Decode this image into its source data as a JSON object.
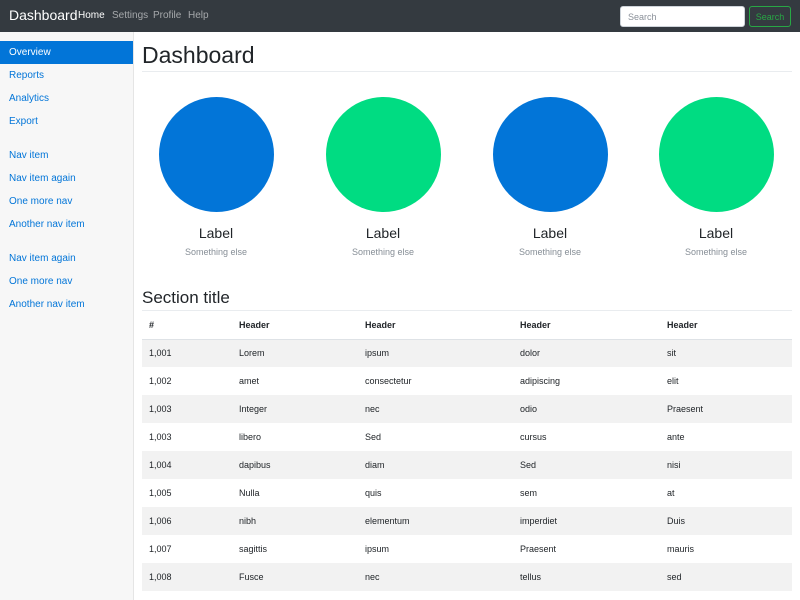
{
  "navbar": {
    "brand": "Dashboard",
    "links": [
      "Home",
      "Settings",
      "Profile",
      "Help"
    ],
    "search_placeholder": "Search",
    "search_button": "Search"
  },
  "sidebar": {
    "groups": [
      [
        "Overview",
        "Reports",
        "Analytics",
        "Export"
      ],
      [
        "Nav item",
        "Nav item again",
        "One more nav",
        "Another nav item"
      ],
      [
        "Nav item again",
        "One more nav",
        "Another nav item"
      ]
    ]
  },
  "main": {
    "title": "Dashboard",
    "tiles": [
      {
        "label": "Label",
        "sublabel": "Something else",
        "color": "#0275d8"
      },
      {
        "label": "Label",
        "sublabel": "Something else",
        "color": "#00dc82"
      },
      {
        "label": "Label",
        "sublabel": "Something else",
        "color": "#0275d8"
      },
      {
        "label": "Label",
        "sublabel": "Something else",
        "color": "#00dc82"
      }
    ],
    "section_title": "Section title",
    "table": {
      "headers": [
        "#",
        "Header",
        "Header",
        "Header",
        "Header"
      ],
      "rows": [
        [
          "1,001",
          "Lorem",
          "ipsum",
          "dolor",
          "sit"
        ],
        [
          "1,002",
          "amet",
          "consectetur",
          "adipiscing",
          "elit"
        ],
        [
          "1,003",
          "Integer",
          "nec",
          "odio",
          "Praesent"
        ],
        [
          "1,003",
          "libero",
          "Sed",
          "cursus",
          "ante"
        ],
        [
          "1,004",
          "dapibus",
          "diam",
          "Sed",
          "nisi"
        ],
        [
          "1,005",
          "Nulla",
          "quis",
          "sem",
          "at"
        ],
        [
          "1,006",
          "nibh",
          "elementum",
          "imperdiet",
          "Duis"
        ],
        [
          "1,007",
          "sagittis",
          "ipsum",
          "Praesent",
          "mauris"
        ],
        [
          "1,008",
          "Fusce",
          "nec",
          "tellus",
          "sed"
        ]
      ]
    }
  },
  "colors": {
    "navbar_bg": "#343a40",
    "primary": "#0275d8",
    "accent_green": "#00dc82",
    "search_button": "#28a745"
  }
}
